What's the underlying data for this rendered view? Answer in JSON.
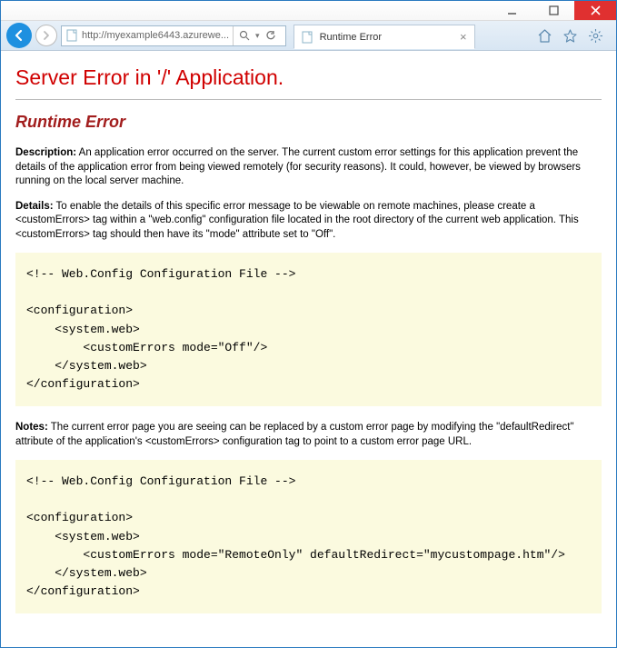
{
  "window": {
    "url_display": "http://myexample6443.azurewe...",
    "tab_title": "Runtime Error"
  },
  "page": {
    "h1": "Server Error in '/' Application.",
    "h2": "Runtime Error",
    "desc_label": "Description:",
    "desc_text": " An application error occurred on the server. The current custom error settings for this application prevent the details of the application error from being viewed remotely (for security reasons). It could, however, be viewed by browsers running on the local server machine.",
    "details_label": "Details:",
    "details_text": " To enable the details of this specific error message to be viewable on remote machines, please create a <customErrors> tag within a \"web.config\" configuration file located in the root directory of the current web application. This <customErrors> tag should then have its \"mode\" attribute set to \"Off\".",
    "code1": "<!-- Web.Config Configuration File -->\n\n<configuration>\n    <system.web>\n        <customErrors mode=\"Off\"/>\n    </system.web>\n</configuration>",
    "notes_label": "Notes:",
    "notes_text": " The current error page you are seeing can be replaced by a custom error page by modifying the \"defaultRedirect\" attribute of the application's <customErrors> configuration tag to point to a custom error page URL.",
    "code2": "<!-- Web.Config Configuration File -->\n\n<configuration>\n    <system.web>\n        <customErrors mode=\"RemoteOnly\" defaultRedirect=\"mycustompage.htm\"/>\n    </system.web>\n</configuration>"
  }
}
